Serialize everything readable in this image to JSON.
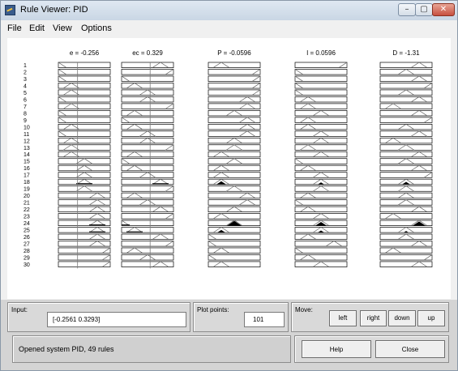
{
  "window": {
    "title": "Rule Viewer: PID"
  },
  "titlebar": {
    "minimize": "–",
    "maximize": "▢",
    "close": "✕"
  },
  "menu": [
    "File",
    "Edit",
    "View",
    "Options"
  ],
  "variables": [
    {
      "label": "e = -0.256",
      "line": 0.37
    },
    {
      "label": "ec = 0.329",
      "line": 0.55
    },
    {
      "label": "P = -0.0596"
    },
    {
      "label": "I = 0.0596"
    },
    {
      "label": "D = -1.31"
    }
  ],
  "rules": {
    "visible_numbers": [
      "1",
      "2",
      "3",
      "4",
      "5",
      "6",
      "7",
      "8",
      "9",
      "10",
      "11",
      "12",
      "13",
      "14",
      "15",
      "16",
      "17",
      "18",
      "19",
      "20",
      "21",
      "22",
      "23",
      "24",
      "25",
      "26",
      "27",
      "28",
      "29",
      "30"
    ],
    "total": 49
  },
  "input": {
    "label": "Input:",
    "value": "[-0.2561 0.3293]"
  },
  "plot_points": {
    "label": "Plot points:",
    "value": "101"
  },
  "move": {
    "label": "Move:",
    "buttons": [
      "left",
      "right",
      "down",
      "up"
    ]
  },
  "status": {
    "text": "Opened system PID, 49 rules"
  },
  "actions": {
    "help": "Help",
    "close": "Close"
  }
}
